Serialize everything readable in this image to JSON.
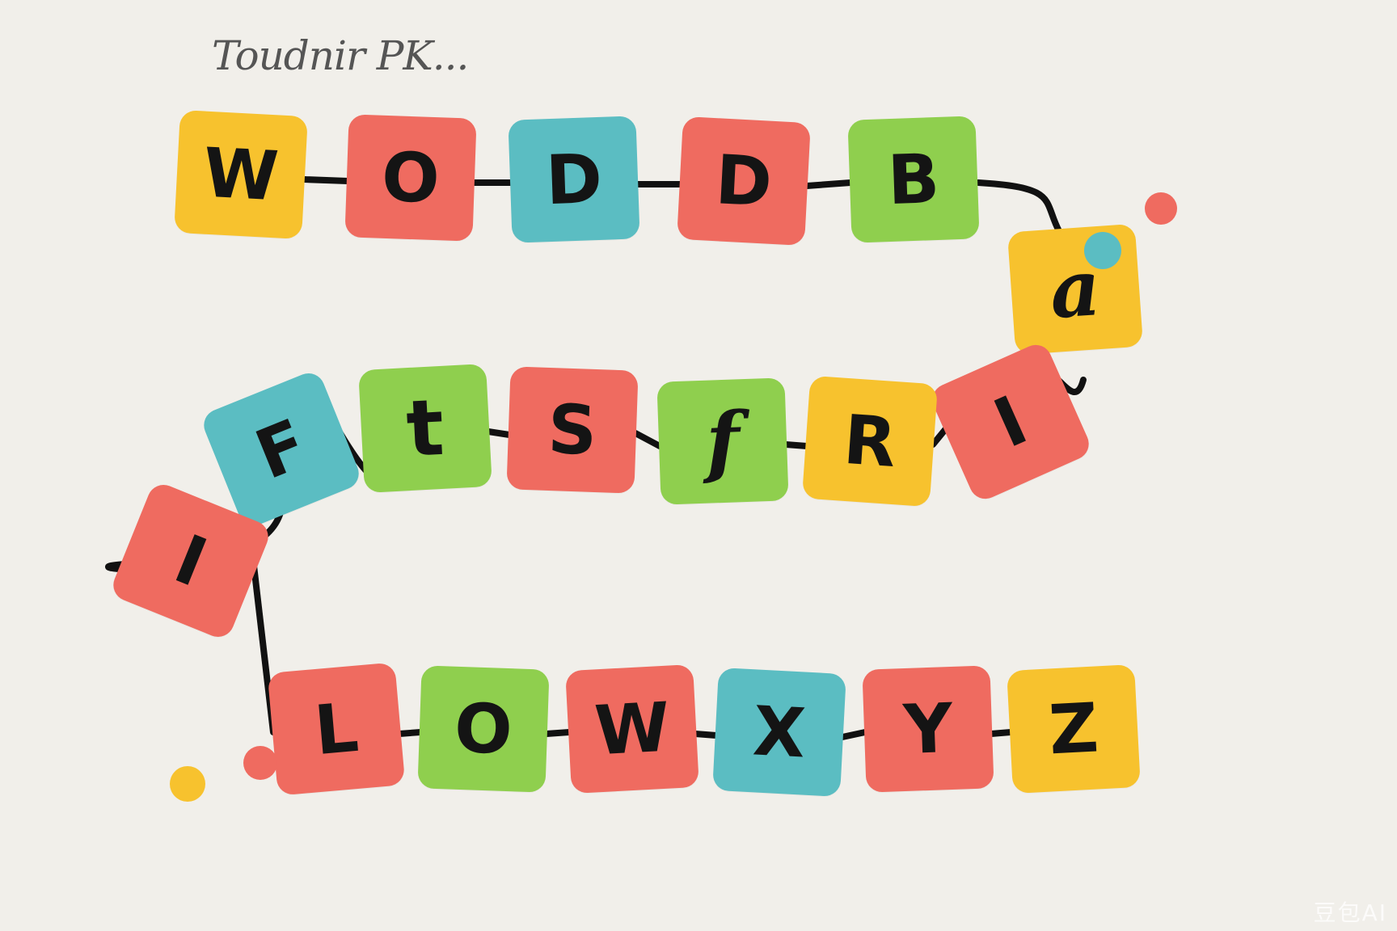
{
  "header": {
    "title": "Toudnir PK..."
  },
  "colors": {
    "background": "#f1efea",
    "yellow": "#f7c22e",
    "red": "#ef6b60",
    "teal": "#5bbdc2",
    "green": "#8fcf4e",
    "line": "#111111"
  },
  "board": {
    "rows": [
      {
        "tiles": [
          {
            "letter": "W",
            "color": "yellow"
          },
          {
            "letter": "O",
            "color": "red"
          },
          {
            "letter": "D",
            "color": "teal"
          },
          {
            "letter": "D",
            "color": "red"
          },
          {
            "letter": "B",
            "color": "green"
          }
        ]
      },
      {
        "tiles": [
          {
            "letter": "a",
            "color": "yellow"
          }
        ]
      },
      {
        "tiles": [
          {
            "letter": "I",
            "color": "red"
          },
          {
            "letter": "R",
            "color": "yellow"
          },
          {
            "letter": "f",
            "color": "green"
          },
          {
            "letter": "S",
            "color": "red"
          },
          {
            "letter": "t",
            "color": "green"
          },
          {
            "letter": "F",
            "color": "teal"
          }
        ]
      },
      {
        "tiles": [
          {
            "letter": "I",
            "color": "red"
          }
        ]
      },
      {
        "tiles": [
          {
            "letter": "L",
            "color": "red"
          },
          {
            "letter": "O",
            "color": "green"
          },
          {
            "letter": "W",
            "color": "red"
          },
          {
            "letter": "X",
            "color": "teal"
          },
          {
            "letter": "Y",
            "color": "red"
          },
          {
            "letter": "Z",
            "color": "yellow"
          }
        ]
      }
    ]
  },
  "decor_dots": [
    {
      "color": "red"
    },
    {
      "color": "teal"
    },
    {
      "color": "red"
    },
    {
      "color": "yellow"
    }
  ],
  "watermark": "豆包AI"
}
